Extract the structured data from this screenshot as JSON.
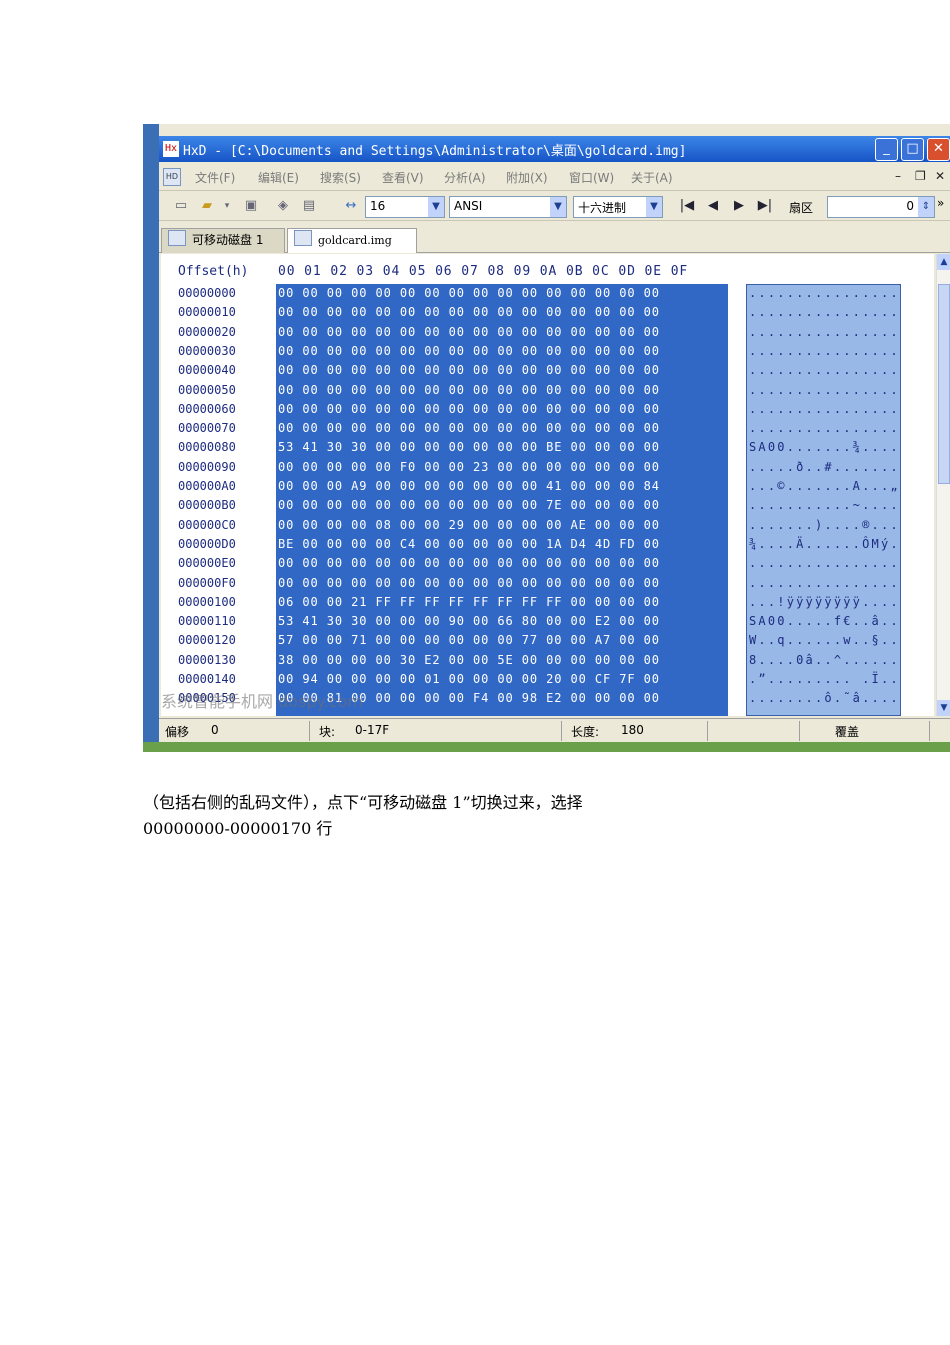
{
  "window": {
    "app_icon": "HxD",
    "title": "HxD - [C:\\Documents and Settings\\Administrator\\桌面\\goldcard.img]",
    "minimize_icon": "minimize-icon",
    "maximize_icon": "maximize-icon",
    "close_icon": "close-icon"
  },
  "menu": {
    "items": [
      "文件(F)",
      "编辑(E)",
      "搜索(S)",
      "查看(V)",
      "分析(A)",
      "附加(X)",
      "窗口(W)",
      "关于(A)"
    ]
  },
  "toolbar": {
    "bytes_per_row": "16",
    "charset": "ANSI",
    "offset_base": "十六进制",
    "sector_label": "扇区",
    "sector_value": "0"
  },
  "tabs": [
    {
      "label": "可移动磁盘 1",
      "active": false
    },
    {
      "label": "goldcard.img",
      "active": true
    }
  ],
  "editor": {
    "offset_header": "Offset(h)",
    "columns": [
      "00",
      "01",
      "02",
      "03",
      "04",
      "05",
      "06",
      "07",
      "08",
      "09",
      "0A",
      "0B",
      "0C",
      "0D",
      "0E",
      "0F"
    ],
    "rows": [
      {
        "offset": "00000000",
        "hex": "00 00 00 00 00 00 00 00 00 00 00 00 00 00 00 00",
        "text": "................"
      },
      {
        "offset": "00000010",
        "hex": "00 00 00 00 00 00 00 00 00 00 00 00 00 00 00 00",
        "text": "................"
      },
      {
        "offset": "00000020",
        "hex": "00 00 00 00 00 00 00 00 00 00 00 00 00 00 00 00",
        "text": "................"
      },
      {
        "offset": "00000030",
        "hex": "00 00 00 00 00 00 00 00 00 00 00 00 00 00 00 00",
        "text": "................"
      },
      {
        "offset": "00000040",
        "hex": "00 00 00 00 00 00 00 00 00 00 00 00 00 00 00 00",
        "text": "................"
      },
      {
        "offset": "00000050",
        "hex": "00 00 00 00 00 00 00 00 00 00 00 00 00 00 00 00",
        "text": "................"
      },
      {
        "offset": "00000060",
        "hex": "00 00 00 00 00 00 00 00 00 00 00 00 00 00 00 00",
        "text": "................"
      },
      {
        "offset": "00000070",
        "hex": "00 00 00 00 00 00 00 00 00 00 00 00 00 00 00 00",
        "text": "................"
      },
      {
        "offset": "00000080",
        "hex": "53 41 30 30 00 00 00 00 00 00 00 BE 00 00 00 00",
        "text": "SA00.......¾...."
      },
      {
        "offset": "00000090",
        "hex": "00 00 00 00 00 F0 00 00 23 00 00 00 00 00 00 00",
        "text": ".....ð..#......."
      },
      {
        "offset": "000000A0",
        "hex": "00 00 00 A9 00 00 00 00 00 00 00 41 00 00 00 84",
        "text": "...©.......A...„"
      },
      {
        "offset": "000000B0",
        "hex": "00 00 00 00 00 00 00 00 00 00 00 7E 00 00 00 00",
        "text": "...........~...."
      },
      {
        "offset": "000000C0",
        "hex": "00 00 00 00 08 00 00 29 00 00 00 00 AE 00 00 00",
        "text": ".......)....®..."
      },
      {
        "offset": "000000D0",
        "hex": "BE 00 00 00 00 C4 00 00 00 00 00 1A D4 4D FD 00",
        "text": "¾....Ä......ÔMý."
      },
      {
        "offset": "000000E0",
        "hex": "00 00 00 00 00 00 00 00 00 00 00 00 00 00 00 00",
        "text": "................"
      },
      {
        "offset": "000000F0",
        "hex": "00 00 00 00 00 00 00 00 00 00 00 00 00 00 00 00",
        "text": "................"
      },
      {
        "offset": "00000100",
        "hex": "06 00 00 21 FF FF FF FF FF FF FF FF 00 00 00 00",
        "text": "...!ÿÿÿÿÿÿÿÿ...."
      },
      {
        "offset": "00000110",
        "hex": "53 41 30 30 00 00 00 90 00 66 80 00 00 E2 00 00",
        "text": "SA00.....f€..â.."
      },
      {
        "offset": "00000120",
        "hex": "57 00 00 71 00 00 00 00 00 00 77 00 00 A7 00 00",
        "text": "W..q......w..§.."
      },
      {
        "offset": "00000130",
        "hex": "38 00 00 00 00 30 E2 00 00 5E 00 00 00 00 00 00",
        "text": "8....0â..^......"
      },
      {
        "offset": "00000140",
        "hex": "00 94 00 00 00 00 01 00 00 00 00 20 00 CF 7F 00",
        "text": ".”......... .Ï.."
      },
      {
        "offset": "00000150",
        "hex": "00 00 81 00 00 00 00 00 F4 00 98 E2 00 00 00 00",
        "text": "........ô.˜â...."
      }
    ]
  },
  "status": {
    "offset_label": "偏移",
    "offset_value": "0",
    "block_label": "块:",
    "block_value": "0-17F",
    "length_label": "长度:",
    "length_value": "180",
    "mode": "覆盖"
  },
  "watermark": "系统智能手机网 dospy.com",
  "paragraph": {
    "line1": "（包括右侧的乱码文件），点下“可移动磁盘 1”切换过来，选择",
    "line2": "00000000-00000170 行"
  }
}
